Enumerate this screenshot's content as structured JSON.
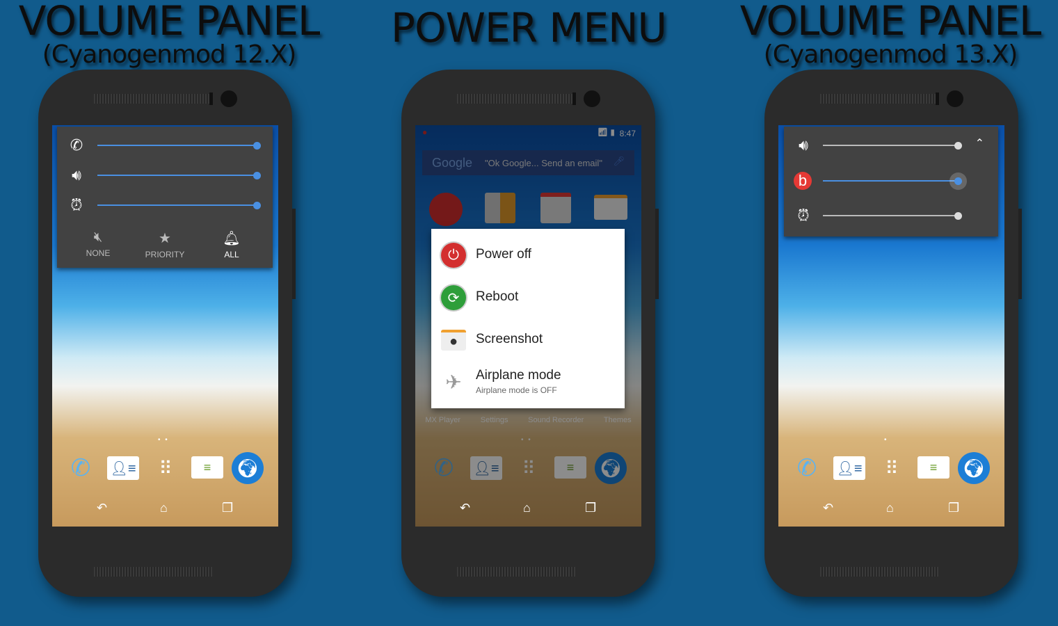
{
  "titles": [
    {
      "title": "VOLUME PANEL",
      "subtitle": "(Cyanogenmod 12.X)"
    },
    {
      "title": "POWER MENU"
    },
    {
      "title": "VOLUME PANEL",
      "subtitle": "(Cyanogenmod 13.X)"
    }
  ],
  "colors": {
    "background": "#115b8c",
    "accent": "#4a90e2",
    "panel": "#424242",
    "power_red": "#d32f2f",
    "reboot_green": "#2e9e3a"
  },
  "phone1": {
    "sliders": [
      {
        "icon": "ringer-icon",
        "level": 1.0
      },
      {
        "icon": "volume-icon",
        "level": 1.0
      },
      {
        "icon": "alarm-icon",
        "level": 1.0
      }
    ],
    "modes": [
      {
        "icon": "mute-icon",
        "label": "NONE"
      },
      {
        "icon": "star-icon",
        "label": "PRIORITY"
      },
      {
        "icon": "bell-icon",
        "label": "ALL",
        "active": true
      }
    ]
  },
  "phone2": {
    "status_time": "8:47",
    "search_logo": "Google",
    "search_hint": "\"Ok Google... Send an email\"",
    "app_labels": [
      "MX Player",
      "Settings",
      "Sound Recorder",
      "Themes"
    ],
    "menu": [
      {
        "icon": "power-icon",
        "label": "Power off"
      },
      {
        "icon": "reboot-icon",
        "label": "Reboot"
      },
      {
        "icon": "screenshot-icon",
        "label": "Screenshot"
      },
      {
        "icon": "airplane-icon",
        "label": "Airplane mode",
        "sub": "Airplane mode is OFF"
      }
    ]
  },
  "phone3": {
    "sliders": [
      {
        "icon": "volume-icon",
        "level": 1.0
      },
      {
        "icon": "beats-icon",
        "level": 1.0,
        "active": true
      },
      {
        "icon": "alarm-icon",
        "level": 1.0
      }
    ]
  },
  "dock": [
    "phone-icon",
    "contacts-icon",
    "apps-icon",
    "messages-icon",
    "browser-icon"
  ],
  "nav": [
    "back-icon",
    "home-icon",
    "recents-icon"
  ]
}
